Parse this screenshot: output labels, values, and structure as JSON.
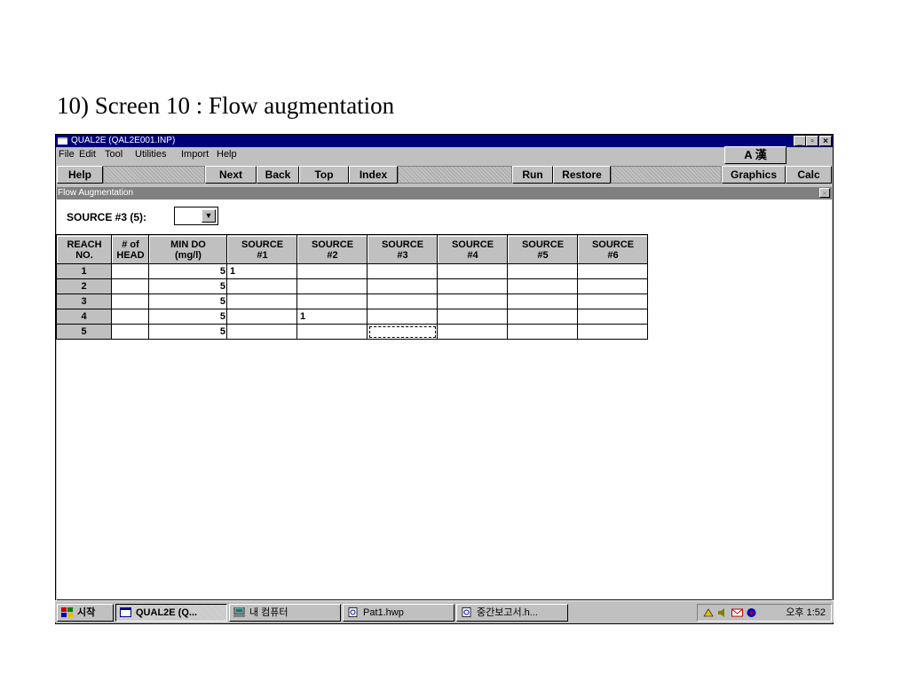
{
  "slide_title": "10) Screen 10 : Flow augmentation",
  "window": {
    "title": "QUAL2E (QAL2E001.INP)",
    "buttons": {
      "minimize": "_",
      "restore": "▫",
      "close": "×"
    }
  },
  "menu": [
    "File",
    "Edit",
    "Tool",
    "Utilities",
    "Import",
    "Help"
  ],
  "ime_indicator": "A 漢",
  "toolbar": {
    "help": "Help",
    "next": "Next",
    "back": "Back",
    "top": "Top",
    "index": "Index",
    "run": "Run",
    "restore": "Restore",
    "graphics": "Graphics",
    "calc": "Calc"
  },
  "subwindow": {
    "title": "Flow Augmentation",
    "close": "×"
  },
  "source_label": "SOURCE #3 (5):",
  "source_value": "",
  "table": {
    "headers": [
      [
        "REACH",
        "NO."
      ],
      [
        "# of",
        "HEAD"
      ],
      [
        "MIN DO",
        "(mg/l)"
      ],
      [
        "SOURCE",
        "#1"
      ],
      [
        "SOURCE",
        "#2"
      ],
      [
        "SOURCE",
        "#3"
      ],
      [
        "SOURCE",
        "#4"
      ],
      [
        "SOURCE",
        "#5"
      ],
      [
        "SOURCE",
        "#6"
      ]
    ],
    "rows": [
      {
        "reach": "1",
        "head": "",
        "min_do": "5",
        "s1": "1",
        "s2": "",
        "s3": "",
        "s4": "",
        "s5": "",
        "s6": ""
      },
      {
        "reach": "2",
        "head": "",
        "min_do": "5",
        "s1": "",
        "s2": "",
        "s3": "",
        "s4": "",
        "s5": "",
        "s6": ""
      },
      {
        "reach": "3",
        "head": "",
        "min_do": "5",
        "s1": "",
        "s2": "",
        "s3": "",
        "s4": "",
        "s5": "",
        "s6": ""
      },
      {
        "reach": "4",
        "head": "",
        "min_do": "5",
        "s1": "",
        "s2": "1",
        "s3": "",
        "s4": "",
        "s5": "",
        "s6": ""
      },
      {
        "reach": "5",
        "head": "",
        "min_do": "5",
        "s1": "",
        "s2": "",
        "s3": "",
        "s4": "",
        "s5": "",
        "s6": ""
      }
    ]
  },
  "taskbar": {
    "start": "시작",
    "tasks": [
      "QUAL2E (Q...",
      "내 컴퓨터",
      "Pat1.hwp",
      "중간보고서.h..."
    ],
    "clock": "오후 1:52"
  },
  "colors": {
    "titlebar": "#00007b",
    "face": "#c0c0c0",
    "subtitle": "#808080"
  }
}
